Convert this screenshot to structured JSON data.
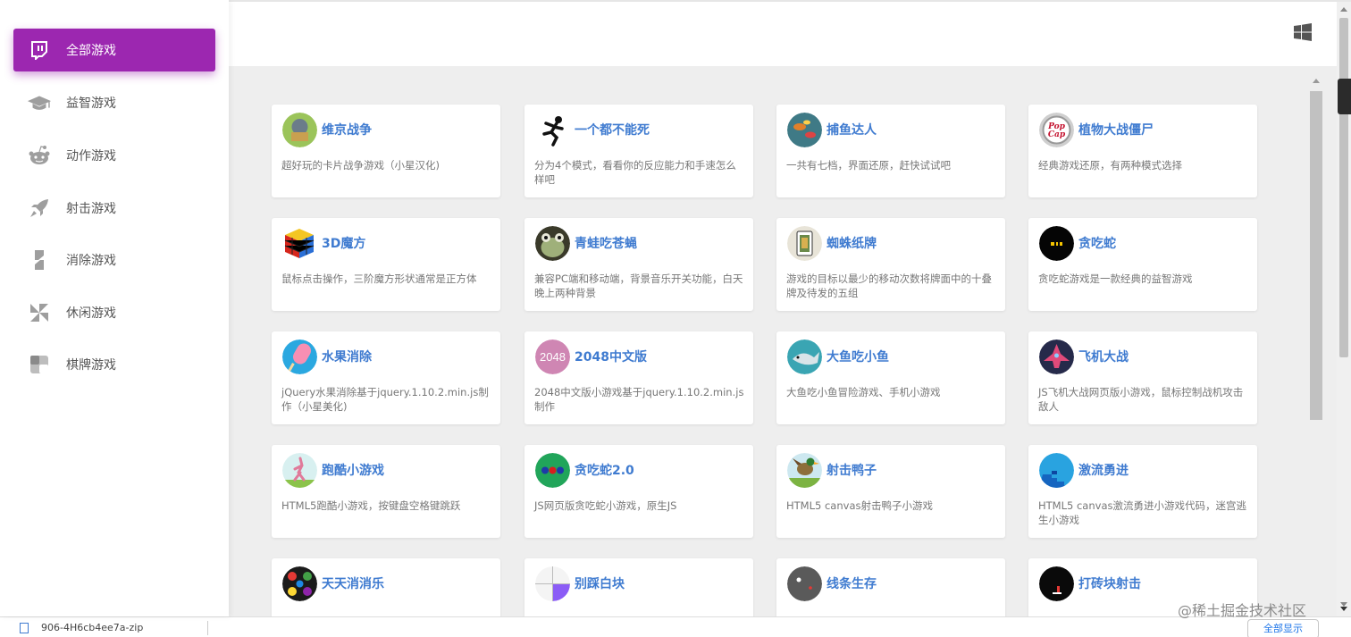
{
  "sidebar": {
    "items": [
      {
        "label": "全部游戏",
        "icon": "twitch-icon",
        "active": true
      },
      {
        "label": "益智游戏",
        "icon": "graduation-cap-icon",
        "active": false
      },
      {
        "label": "动作游戏",
        "icon": "reddit-icon",
        "active": false
      },
      {
        "label": "射击游戏",
        "icon": "rocket-icon",
        "active": false
      },
      {
        "label": "消除游戏",
        "icon": "lightning-icon",
        "active": false
      },
      {
        "label": "休闲游戏",
        "icon": "pinwheel-icon",
        "active": false
      },
      {
        "label": "棋牌游戏",
        "icon": "checkerboard-icon",
        "active": false
      }
    ]
  },
  "header": {
    "icon": "windows-icon"
  },
  "games": [
    {
      "title": "维京战争",
      "desc": "超好玩的卡片战争游戏（小星汉化)"
    },
    {
      "title": "一个都不能死",
      "desc": "分为4个模式，看看你的反应能力和手速怎么样吧"
    },
    {
      "title": "捕鱼达人",
      "desc": "一共有七档，界面还原，赶快试试吧"
    },
    {
      "title": "植物大战僵尸",
      "desc": "经典游戏还原，有两种模式选择"
    },
    {
      "title": "3D魔方",
      "desc": "鼠标点击操作，三阶魔方形状通常是正方体"
    },
    {
      "title": "青蛙吃苍蝇",
      "desc": "兼容PC端和移动端，背景音乐开关功能，白天晚上两种背景"
    },
    {
      "title": "蜘蛛纸牌",
      "desc": "游戏的目标以最少的移动次数将牌面中的十叠牌及待发的五组"
    },
    {
      "title": "贪吃蛇",
      "desc": "贪吃蛇游戏是一款经典的益智游戏"
    },
    {
      "title": "水果消除",
      "desc": "jQuery水果消除基于jquery.1.10.2.min.js制作（小星美化)"
    },
    {
      "title": "2048中文版",
      "desc": "2048中文版小游戏基于jquery.1.10.2.min.js制作"
    },
    {
      "title": "大鱼吃小鱼",
      "desc": "大鱼吃小鱼冒险游戏、手机小游戏"
    },
    {
      "title": "飞机大战",
      "desc": "JS飞机大战网页版小游戏，鼠标控制战机攻击敌人"
    },
    {
      "title": "跑酷小游戏",
      "desc": "HTML5跑酷小游戏，按键盘空格键跳跃"
    },
    {
      "title": "贪吃蛇2.0",
      "desc": "JS网页版贪吃蛇小游戏，原生JS"
    },
    {
      "title": "射击鸭子",
      "desc": "HTML5 canvas射击鸭子小游戏"
    },
    {
      "title": "激流勇进",
      "desc": "HTML5 canvas激流勇进小游戏代码，迷宫逃生小游戏"
    },
    {
      "title": "天天消消乐",
      "desc": ""
    },
    {
      "title": "别踩白块",
      "desc": ""
    },
    {
      "title": "线条生存",
      "desc": ""
    },
    {
      "title": "打砖块射击",
      "desc": ""
    }
  ],
  "thumb_text_2048": "2048",
  "colors": {
    "accent": "#9c27b0",
    "title_blue": "#3f7bd0"
  },
  "watermark": "@稀土掘金技术社区",
  "bottom_bar": {
    "file": "906-4H6cb4ee7a-zip",
    "show_all": "全部显示"
  }
}
